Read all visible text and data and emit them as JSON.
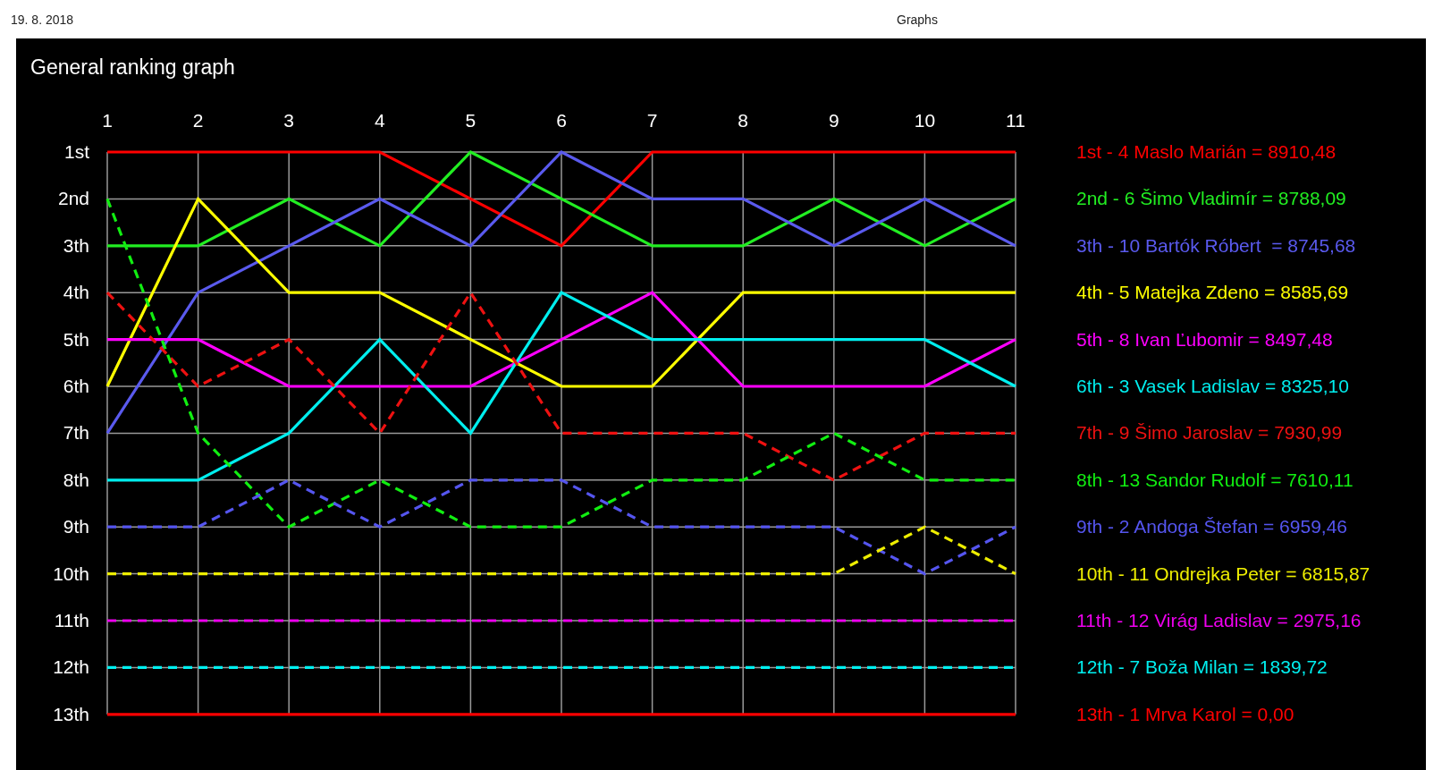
{
  "header": {
    "date": "19. 8. 2018",
    "title": "Graphs"
  },
  "chart": {
    "title": "General ranking graph",
    "chart_data": {
      "type": "line",
      "grid": true,
      "categories": [
        "1",
        "2",
        "3",
        "4",
        "5",
        "6",
        "7",
        "8",
        "9",
        "10",
        "11"
      ],
      "ylim": [
        13,
        1
      ],
      "yticks": [
        {
          "value": 1,
          "label": "1st"
        },
        {
          "value": 2,
          "label": "2nd"
        },
        {
          "value": 3,
          "label": "3th"
        },
        {
          "value": 4,
          "label": "4th"
        },
        {
          "value": 5,
          "label": "5th"
        },
        {
          "value": 6,
          "label": "6th"
        },
        {
          "value": 7,
          "label": "7th"
        },
        {
          "value": 8,
          "label": "8th"
        },
        {
          "value": 9,
          "label": "9th"
        },
        {
          "value": 10,
          "label": "10th"
        },
        {
          "value": 11,
          "label": "11th"
        },
        {
          "value": 12,
          "label": "12th"
        },
        {
          "value": 13,
          "label": "13th"
        }
      ],
      "series": [
        {
          "name": "1st - 4 Maslo Marián = 8910,48",
          "color": "#ff0000",
          "line_style": "solid",
          "values": [
            1,
            1,
            1,
            1,
            2,
            3,
            1,
            1,
            1,
            1,
            1
          ]
        },
        {
          "name": "2nd - 6 Šimo Vladimír = 8788,09",
          "color": "#22ee22",
          "line_style": "solid",
          "values": [
            3,
            3,
            2,
            3,
            1,
            2,
            3,
            3,
            2,
            3,
            2
          ]
        },
        {
          "name": "3th - 10 Bartók Róbert  = 8745,68",
          "color": "#5a5aee",
          "line_style": "solid",
          "values": [
            7,
            4,
            3,
            2,
            3,
            1,
            2,
            2,
            3,
            2,
            3
          ]
        },
        {
          "name": "4th - 5 Matejka Zdeno = 8585,69",
          "color": "#ffff00",
          "line_style": "solid",
          "values": [
            6,
            2,
            4,
            4,
            5,
            6,
            6,
            4,
            4,
            4,
            4
          ]
        },
        {
          "name": "5th - 8 Ivan Ľubomir = 8497,48",
          "color": "#ff00ff",
          "line_style": "solid",
          "values": [
            5,
            5,
            6,
            6,
            6,
            5,
            4,
            6,
            6,
            6,
            5
          ]
        },
        {
          "name": "6th - 3 Vasek Ladislav = 8325,10",
          "color": "#00eeee",
          "line_style": "solid",
          "values": [
            8,
            8,
            7,
            5,
            7,
            4,
            5,
            5,
            5,
            5,
            6
          ]
        },
        {
          "name": "7th - 9 Šimo Jaroslav = 7930,99",
          "color": "#ee1111",
          "line_style": "dashed",
          "values": [
            4,
            6,
            5,
            7,
            4,
            7,
            7,
            7,
            8,
            7,
            7
          ]
        },
        {
          "name": "8th - 13 Sandor Rudolf = 7610,11",
          "color": "#11ee11",
          "line_style": "dashed",
          "values": [
            2,
            7,
            9,
            8,
            9,
            9,
            8,
            8,
            7,
            8,
            8
          ]
        },
        {
          "name": "9th - 2 Andoga Štefan = 6959,46",
          "color": "#5555ef",
          "line_style": "dashed",
          "values": [
            9,
            9,
            8,
            9,
            8,
            8,
            9,
            9,
            9,
            10,
            9
          ]
        },
        {
          "name": "10th - 11 Ondrejka Peter = 6815,87",
          "color": "#eeee00",
          "line_style": "dashed",
          "values": [
            10,
            10,
            10,
            10,
            10,
            10,
            10,
            10,
            10,
            9,
            10
          ]
        },
        {
          "name": "11th - 12 Virág Ladislav = 2975,16",
          "color": "#ee00ee",
          "line_style": "dashed",
          "values": [
            11,
            11,
            11,
            11,
            11,
            11,
            11,
            11,
            11,
            11,
            11
          ]
        },
        {
          "name": "12th - 7 Boža Milan = 1839,72",
          "color": "#00efef",
          "line_style": "dashed",
          "values": [
            12,
            12,
            12,
            12,
            12,
            12,
            12,
            12,
            12,
            12,
            12
          ]
        },
        {
          "name": "13th - 1 Mrva Karol = 0,00",
          "color": "#ff0101",
          "line_style": "solid",
          "values": [
            13,
            13,
            13,
            13,
            13,
            13,
            13,
            13,
            13,
            13,
            13
          ]
        }
      ]
    }
  }
}
